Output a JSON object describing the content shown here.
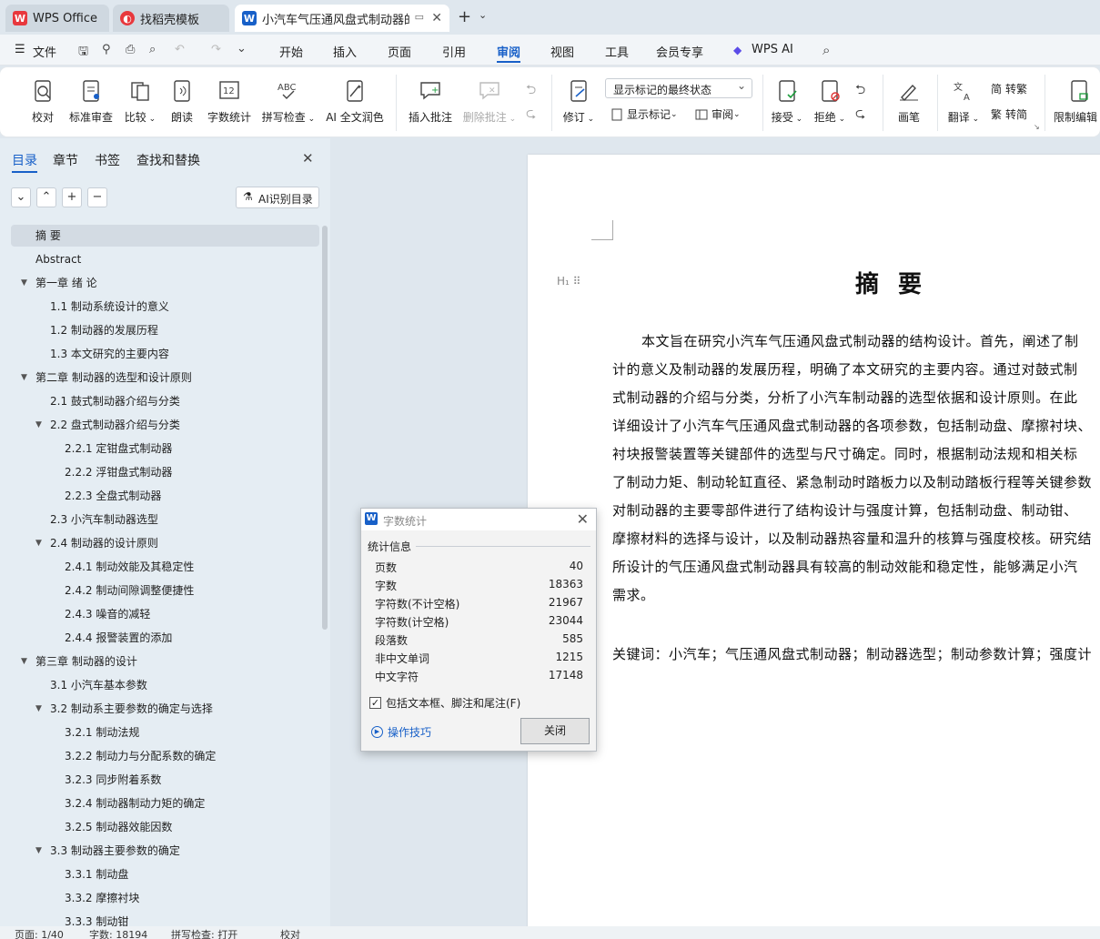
{
  "tabs": [
    {
      "label": "WPS Office",
      "icon": "wps-logo-icon"
    },
    {
      "label": "找稻壳模板",
      "icon": "docer-logo-icon"
    },
    {
      "label": "小汽车气压通风盘式制动器的",
      "icon": "wps-writer-icon"
    }
  ],
  "menu": {
    "file": "文件",
    "items": [
      "开始",
      "插入",
      "页面",
      "引用",
      "审阅",
      "视图",
      "工具",
      "会员专享",
      "WPS AI"
    ],
    "selected": "审阅"
  },
  "ribbon": {
    "proofread": "校对",
    "std_review": "标准审查",
    "compare": "比较",
    "read_aloud": "朗读",
    "word_count": "字数统计",
    "spell_check": "拼写检查",
    "ai_polish": "AI 全文润色",
    "insert_comment": "插入批注",
    "delete_comment": "删除批注",
    "revise": "修订",
    "markup_combo": "显示标记的最终状态",
    "show_markup": "显示标记",
    "review": "审阅",
    "accept": "接受",
    "reject": "拒绝",
    "pen": "画笔",
    "translate": "翻译",
    "to_trad": "转繁",
    "to_simp": "转简",
    "restrict_edit": "限制编辑"
  },
  "sidebar": {
    "tabs": [
      "目录",
      "章节",
      "书签",
      "查找和替换"
    ],
    "ai_toc": "AI识别目录",
    "toc": [
      {
        "label": "摘  要",
        "level": 1
      },
      {
        "label": "Abstract",
        "level": 1
      },
      {
        "label": "第一章 绪  论",
        "level": 1,
        "expanded": true
      },
      {
        "label": "1.1 制动系统设计的意义",
        "level": 2
      },
      {
        "label": "1.2 制动器的发展历程",
        "level": 2
      },
      {
        "label": "1.3 本文研究的主要内容",
        "level": 2
      },
      {
        "label": "第二章  制动器的选型和设计原则",
        "level": 1,
        "expanded": true
      },
      {
        "label": "2.1 鼓式制动器介绍与分类",
        "level": 2
      },
      {
        "label": "2.2 盘式制动器介绍与分类",
        "level": 2,
        "expanded": true
      },
      {
        "label": "2.2.1 定钳盘式制动器",
        "level": 3
      },
      {
        "label": "2.2.2 浮钳盘式制动器",
        "level": 3
      },
      {
        "label": "2.2.3 全盘式制动器",
        "level": 3
      },
      {
        "label": "2.3 小汽车制动器选型",
        "level": 2
      },
      {
        "label": "2.4 制动器的设计原则",
        "level": 2,
        "expanded": true
      },
      {
        "label": "2.4.1 制动效能及其稳定性",
        "level": 3
      },
      {
        "label": "2.4.2 制动间隙调整便捷性",
        "level": 3
      },
      {
        "label": "2.4.3 噪音的减轻",
        "level": 3
      },
      {
        "label": "2.4.4 报警装置的添加",
        "level": 3
      },
      {
        "label": "第三章 制动器的设计",
        "level": 1,
        "expanded": true
      },
      {
        "label": "3.1 小汽车基本参数",
        "level": 2
      },
      {
        "label": "3.2 制动系主要参数的确定与选择",
        "level": 2,
        "expanded": true
      },
      {
        "label": "3.2.1 制动法规",
        "level": 3
      },
      {
        "label": "3.2.2 制动力与分配系数的确定",
        "level": 3
      },
      {
        "label": "3.2.3 同步附着系数",
        "level": 3
      },
      {
        "label": "3.2.4 制动器制动力矩的确定",
        "level": 3
      },
      {
        "label": "3.2.5 制动器效能因数",
        "level": 3
      },
      {
        "label": "3.3 制动器主要参数的确定",
        "level": 2,
        "expanded": true
      },
      {
        "label": "3.3.1 制动盘",
        "level": 3
      },
      {
        "label": "3.3.2 摩擦衬块",
        "level": 3
      },
      {
        "label": "3.3.3 制动钳",
        "level": 3
      }
    ]
  },
  "document": {
    "title": "摘  要",
    "lines": [
      "本文旨在研究小汽车气压通风盘式制动器的结构设计。首先，阐述了制",
      "计的意义及制动器的发展历程，明确了本文研究的主要内容。通过对鼓式制",
      "式制动器的介绍与分类，分析了小汽车制动器的选型依据和设计原则。在此",
      "详细设计了小汽车气压通风盘式制动器的各项参数，包括制动盘、摩擦衬块、",
      "衬块报警装置等关键部件的选型与尺寸确定。同时，根据制动法规和相关标",
      "了制动力矩、制动轮缸直径、紧急制动时踏板力以及制动踏板行程等关键参数",
      "对制动器的主要零部件进行了结构设计与强度计算，包括制动盘、制动钳、",
      "摩擦材料的选择与设计，以及制动器热容量和温升的核算与强度校核。研究结",
      "所设计的气压通风盘式制动器具有较高的制动效能和稳定性，能够满足小汽",
      "需求。"
    ],
    "keywords": "关键词：小汽车；气压通风盘式制动器；制动器选型；制动参数计算；强度计"
  },
  "dialog": {
    "title": "字数统计",
    "group": "统计信息",
    "rows": [
      {
        "label": "页数",
        "value": "40"
      },
      {
        "label": "字数",
        "value": "18363"
      },
      {
        "label": "字符数(不计空格)",
        "value": "21967"
      },
      {
        "label": "字符数(计空格)",
        "value": "23044"
      },
      {
        "label": "段落数",
        "value": "585"
      },
      {
        "label": "非中文单词",
        "value": "1215"
      },
      {
        "label": "中文字符",
        "value": "17148"
      }
    ],
    "checkbox": "包括文本框、脚注和尾注(F)",
    "checked": true,
    "tips": "操作技巧",
    "close": "关闭"
  },
  "status": {
    "page": "页面: 1/40",
    "words": "字数: 18194",
    "spell": "拼写检查: 打开",
    "proof": "校对"
  },
  "colors": {
    "accent": "#1860c8",
    "wps_red": "#e8383d",
    "bg": "#dfe7ee"
  }
}
